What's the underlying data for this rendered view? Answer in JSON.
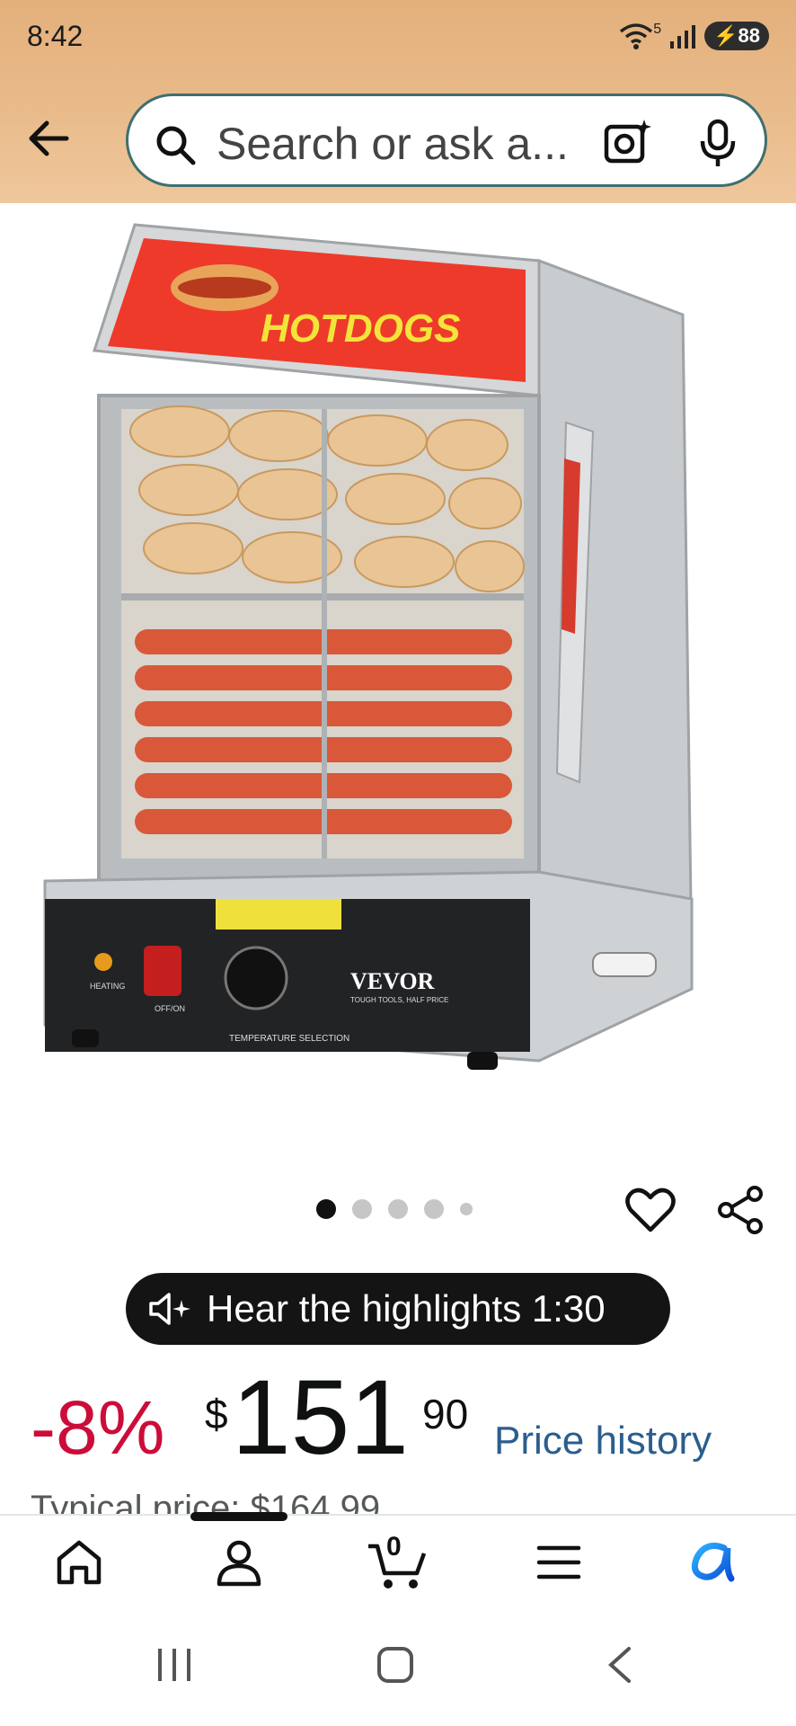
{
  "status_bar": {
    "time": "8:42",
    "network": "5",
    "battery": "88"
  },
  "search": {
    "placeholder": "Search or ask a..."
  },
  "product_image": {
    "sign_text": "HOTDOGS",
    "brand": "VEVOR",
    "brand_tagline": "TOUGH TOOLS, HALF PRICE",
    "switch_label": "OFF/ON",
    "heating_label": "HEATING",
    "temp_label": "TEMPERATURE SELECTION"
  },
  "carousel": {
    "count": 5,
    "active": 0
  },
  "audio": {
    "label": "Hear the highlights 1:30"
  },
  "price": {
    "discount": "-8%",
    "currency": "$",
    "whole": "151",
    "fraction": "90",
    "history_link": "Price history",
    "typical_text": "Typical price: $164.99"
  },
  "bottom_nav": {
    "cart_count": "0",
    "items": [
      "home",
      "account",
      "cart",
      "menu",
      "rufus"
    ]
  },
  "colors": {
    "discount": "#cc0c39",
    "link": "#2a5e8e",
    "header": "#e3b07b"
  }
}
